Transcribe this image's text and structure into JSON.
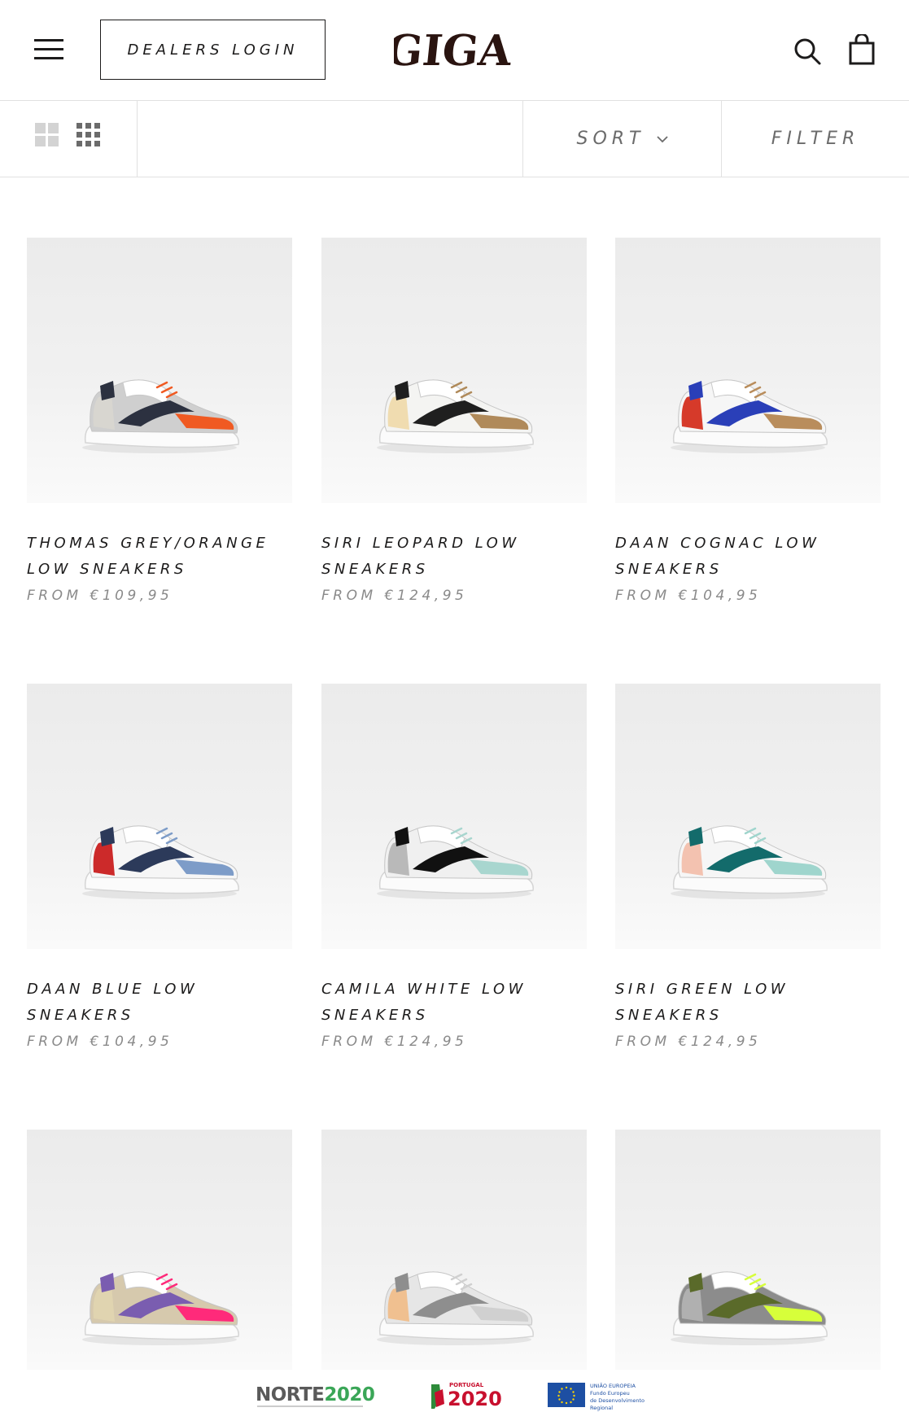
{
  "header": {
    "dealers_login": "Dealers Login",
    "logo_text": "GIGA"
  },
  "toolbar": {
    "sort_label": "Sort",
    "filter_label": "Filter"
  },
  "products": [
    {
      "title": "Thomas Grey/Orange Low Sneakers",
      "price": "From €109,95",
      "colors": {
        "main": "#cfcfcf",
        "accent": "#f05a22",
        "dark": "#2c3140",
        "heel": "#d8d6d0"
      }
    },
    {
      "title": "Siri Leopard Low Sneakers",
      "price": "From €124,95",
      "colors": {
        "main": "#f4f4f2",
        "accent": "#b08a5a",
        "dark": "#1f1f1f",
        "heel": "#f0dcb0"
      }
    },
    {
      "title": "Daan Cognac Low Sneakers",
      "price": "From €104,95",
      "colors": {
        "main": "#f6f6f6",
        "accent": "#b98d5c",
        "dark": "#2a3fb8",
        "heel": "#d63a2a"
      }
    },
    {
      "title": "Daan Blue Low Sneakers",
      "price": "From €104,95",
      "colors": {
        "main": "#f6f6f6",
        "accent": "#7d9cc8",
        "dark": "#2c3a5a",
        "heel": "#cc2a2a"
      }
    },
    {
      "title": "Camila White Low Sneakers",
      "price": "From €124,95",
      "colors": {
        "main": "#f0f0f0",
        "accent": "#a8d6cf",
        "dark": "#111111",
        "heel": "#b9b9b9"
      }
    },
    {
      "title": "Siri Green Low Sneakers",
      "price": "From €124,95",
      "colors": {
        "main": "#f6f6f6",
        "accent": "#9fd5cd",
        "dark": "#136b6b",
        "heel": "#f3c2b0"
      }
    },
    {
      "title": "",
      "price": "",
      "colors": {
        "main": "#d6c9ad",
        "accent": "#ff2a7a",
        "dark": "#7a5db0",
        "heel": "#e0d4b0"
      }
    },
    {
      "title": "",
      "price": "",
      "colors": {
        "main": "#e6e6e6",
        "accent": "#d0d0d0",
        "dark": "#8e8e8e",
        "heel": "#f0c090"
      }
    },
    {
      "title": "",
      "price": "",
      "colors": {
        "main": "#8c8c8c",
        "accent": "#d7ff3a",
        "dark": "#5a6a2a",
        "heel": "#b0b0b0"
      }
    }
  ],
  "footer": {
    "norte_a": "NORTE",
    "norte_b": "2020",
    "portugal_label": "PORTUGAL",
    "portugal_year": "2020",
    "eu_line1": "UNIÃO EUROPEIA",
    "eu_line2": "Fundo Europeu",
    "eu_line3": "de Desenvolvimento Regional"
  }
}
